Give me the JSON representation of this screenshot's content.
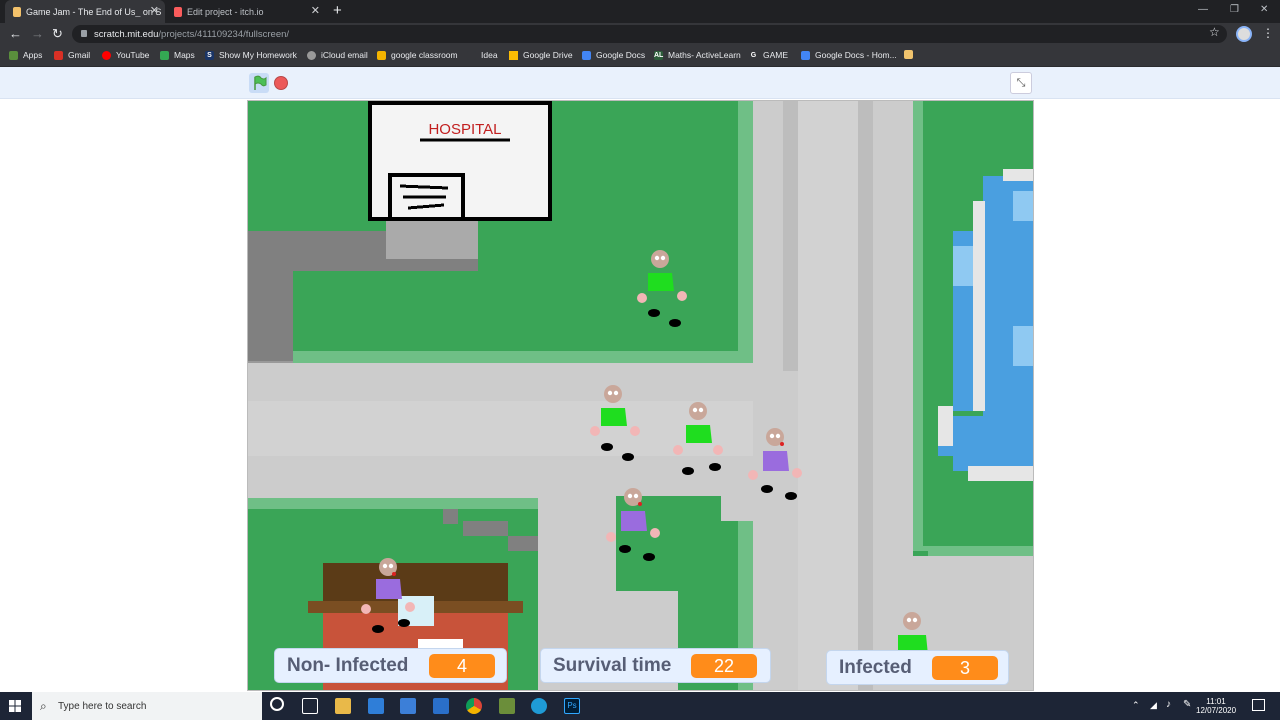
{
  "browser": {
    "tabs": [
      {
        "title": "Game Jam - The End of Us_ on S",
        "close": "✕"
      },
      {
        "title": "Edit project - itch.io",
        "close": "✕"
      }
    ],
    "new_tab": "+",
    "url_host": "scratch.mit.edu",
    "url_path": "/projects/411109234/fullscreen/",
    "bookmarks": [
      "Apps",
      "Gmail",
      "YouTube",
      "Maps",
      "Show My Homework",
      "iCloud email",
      "google classroom",
      "Idea",
      "Google Drive",
      "Google Docs",
      "Maths- ActiveLearn",
      "GAME",
      "Google Docs - Hom..."
    ]
  },
  "stage": {
    "sign": "HOSPITAL",
    "monitors": [
      {
        "label": "Non- Infected",
        "value": "4"
      },
      {
        "label": "Survival time",
        "value": "22"
      },
      {
        "label": "Infected",
        "value": "3"
      }
    ]
  },
  "taskbar": {
    "search_placeholder": "Type here to search",
    "time": "11:01",
    "date": "12/07/2020"
  },
  "colors": {
    "grass": "#3aa557",
    "road": "#cccccc",
    "water": "#4a9fe0",
    "healthy": "#1fdd1f",
    "infected": "#9a6cde",
    "monitor_value": "#ff8c1a"
  },
  "icons": [
    "green-flag-icon",
    "stop-icon",
    "fullscreen-exit-icon",
    "windows-start-icon",
    "search-icon",
    "chrome-icon",
    "lock-icon",
    "star-icon"
  ]
}
